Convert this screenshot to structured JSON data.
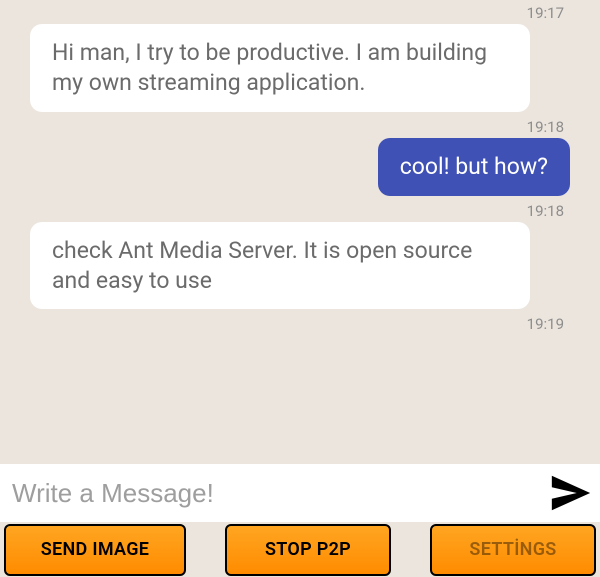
{
  "messages": [
    {
      "side": "in",
      "text": "Hi man, I try to be productive. I am building my own streaming application.",
      "ts": "19:17"
    },
    {
      "side": "out",
      "text": "cool! but how?",
      "ts": "19:18"
    },
    {
      "side": "in",
      "text": "check Ant Media Server. It is open source and easy to use",
      "ts": "19:18"
    }
  ],
  "trailing_ts": "19:19",
  "composer": {
    "placeholder": "Write a Message!"
  },
  "buttons": {
    "send_image": "SEND IMAGE",
    "stop_p2p": "STOP P2P",
    "settings": "SETTİNGS"
  }
}
